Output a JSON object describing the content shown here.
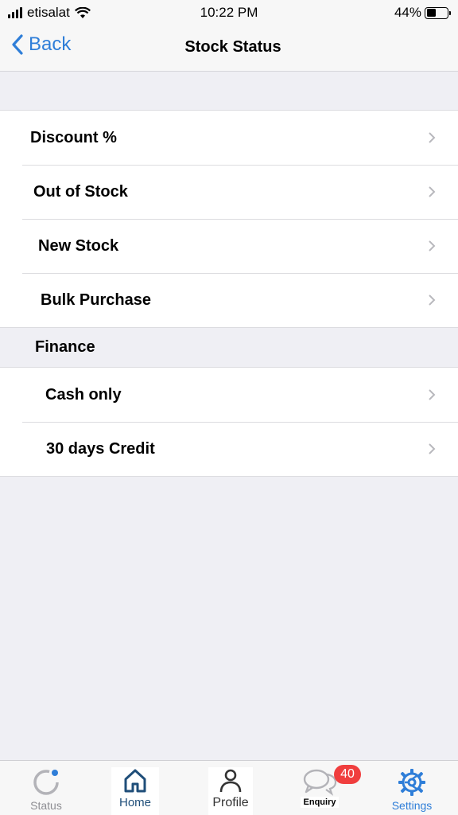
{
  "status_bar": {
    "carrier": "etisalat",
    "time": "10:22 PM",
    "battery_percent": "44%",
    "battery_level": 0.44
  },
  "nav": {
    "back_label": "Back",
    "title": "Stock Status"
  },
  "stock_items": [
    {
      "label": "Discount %"
    },
    {
      "label": "Out of Stock"
    },
    {
      "label": "New Stock"
    },
    {
      "label": "Bulk Purchase"
    }
  ],
  "finance": {
    "header": "Finance",
    "items": [
      {
        "label": "Cash only"
      },
      {
        "label": "30 days Credit"
      }
    ]
  },
  "tabs": {
    "status": "Status",
    "home": "Home",
    "profile": "Profile",
    "enquiry": "Enquiry",
    "enquiry_badge": "40",
    "settings": "Settings"
  },
  "colors": {
    "accent": "#2f7ed8",
    "badge": "#f03e3e",
    "home_icon": "#1f4e79"
  }
}
